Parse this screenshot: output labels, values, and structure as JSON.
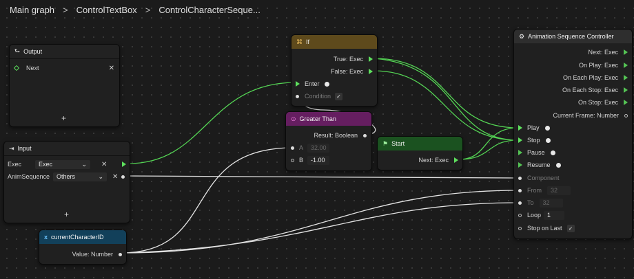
{
  "breadcrumb": [
    "Main graph",
    "ControlTextBox",
    "ControlCharacterSeque..."
  ],
  "separator": ">",
  "colors": {
    "exec": "#5ee05e",
    "wire": "#e8e8e8",
    "if_header": "#5e4a1c",
    "gt_header": "#651e60",
    "start_header": "#1b5220",
    "var_header": "#12405a",
    "asc_header": "#2e2e2e"
  },
  "output_node": {
    "title": "Output",
    "items": [
      {
        "label": "Next",
        "remove": "✕"
      }
    ],
    "add": "+"
  },
  "input_node": {
    "title": "Input",
    "rows": [
      {
        "label": "Exec",
        "value": "Exec",
        "caret": "⌄",
        "remove": "✕"
      },
      {
        "label": "AnimSequence",
        "value": "Others",
        "caret": "⌄",
        "remove": "✕"
      }
    ],
    "add": "+"
  },
  "if_node": {
    "title": "If",
    "true_label": "True: Exec",
    "false_label": "False: Exec",
    "enter_label": "Enter",
    "condition_label": "Condition",
    "condition_check": "✓"
  },
  "gt_node": {
    "title": "Greater Than",
    "result_label": "Result: Boolean",
    "a_label": "A",
    "a_value": "32.00",
    "b_label": "B",
    "b_value": "-1.00"
  },
  "start_node": {
    "title": "Start",
    "next_label": "Next: Exec"
  },
  "var_node": {
    "title": "currentCharacterID",
    "icon": "x",
    "value_label": "Value: Number"
  },
  "asc_node": {
    "title": "Animation Sequence Controller",
    "outputs": [
      "Next: Exec",
      "On Play: Exec",
      "On Each Play: Exec",
      "On Each Stop: Exec",
      "On Stop: Exec",
      "Current Frame: Number"
    ],
    "inputs": {
      "play": "Play",
      "stop": "Stop",
      "pause": "Pause",
      "resume": "Resume",
      "component": "Component",
      "from": "From",
      "from_value": "32",
      "to": "To",
      "to_value": "32",
      "loop": "Loop",
      "loop_value": "1",
      "stop_on_last": "Stop on Last",
      "stop_on_last_check": "✓"
    }
  }
}
